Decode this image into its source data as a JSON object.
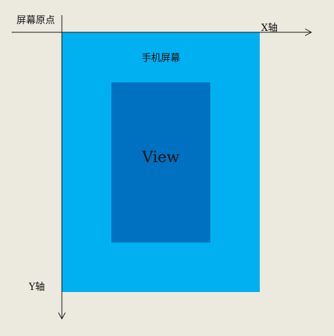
{
  "labels": {
    "origin": "屏幕原点",
    "x_axis": "X轴",
    "y_axis": "Y轴",
    "screen": "手机屏幕",
    "view": "View"
  },
  "colors": {
    "background": "#ECE9DF",
    "screen": "#00B0F0",
    "view": "#0070C0",
    "axis": "#111111"
  }
}
